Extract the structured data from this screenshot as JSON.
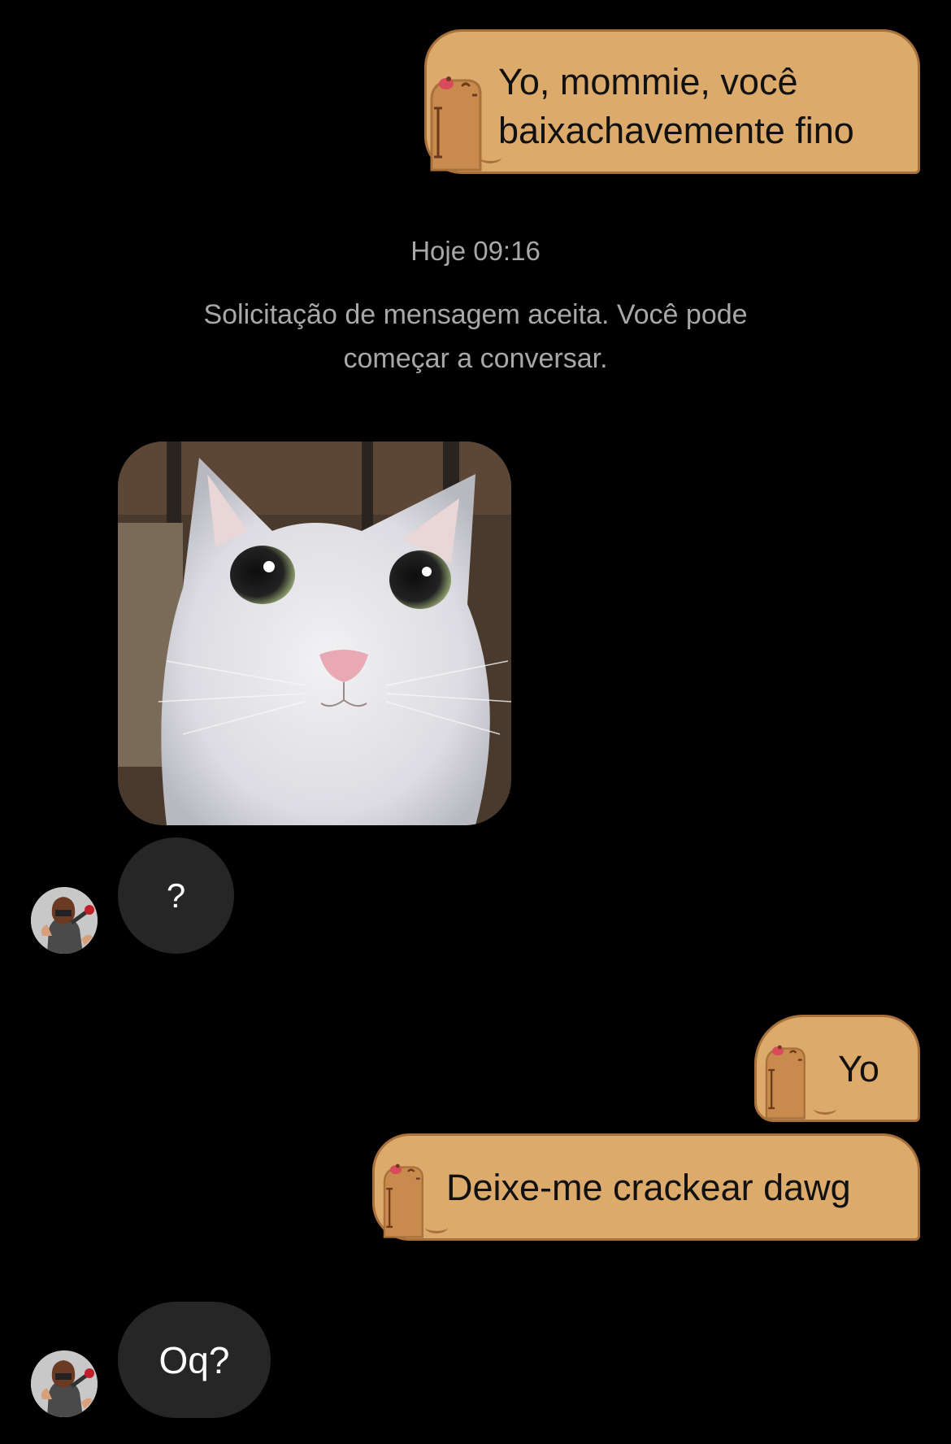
{
  "conversation": {
    "timestamp": "Hoje 09:16",
    "system_message": "Solicitação de mensagem aceita. Você pode começar a conversar.",
    "messages": [
      {
        "sender": "me",
        "style": "capybara-bubble",
        "text": "Yo, mommie, você\nbaixachavemente fino"
      },
      {
        "sender": "them",
        "type": "image",
        "image": "white cat staring"
      },
      {
        "sender": "them",
        "type": "text",
        "text": "?"
      },
      {
        "sender": "me",
        "style": "capybara-bubble",
        "text": "Yo"
      },
      {
        "sender": "me",
        "style": "capybara-bubble",
        "text": "Deixe-me crackear dawg"
      },
      {
        "sender": "them",
        "type": "text",
        "text": "Oq?"
      }
    ]
  },
  "theme": {
    "background": "#000000",
    "outgoing_bubble": "#dcaa6b",
    "outgoing_border": "#a8713c",
    "incoming_bubble": "#262626",
    "system_text": "#a8a8a8"
  }
}
